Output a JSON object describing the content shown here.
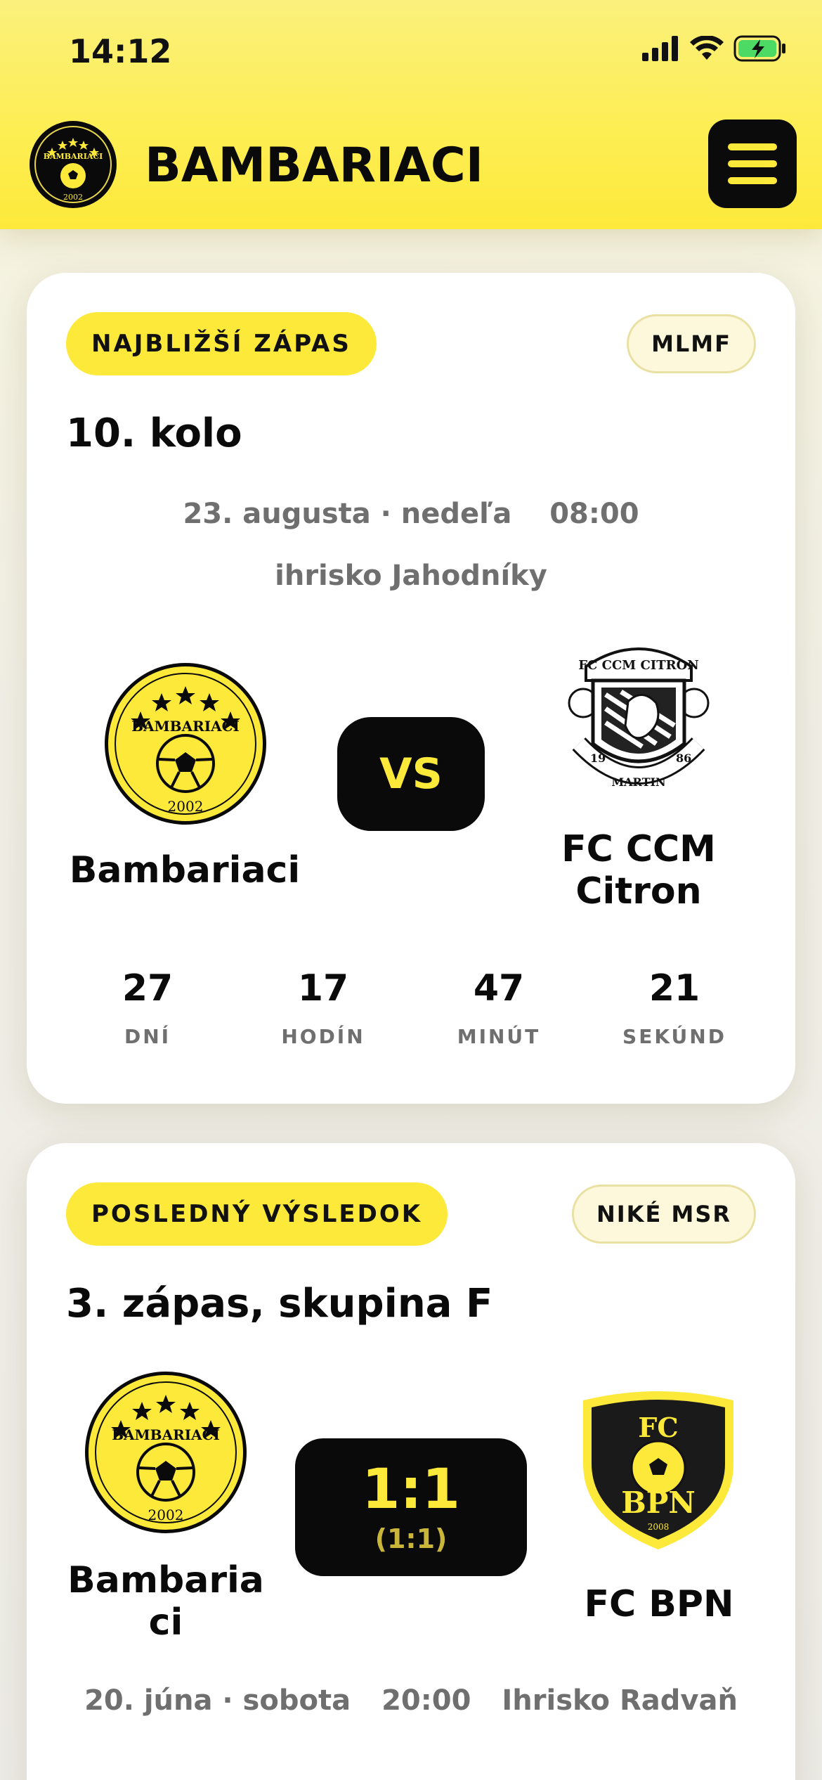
{
  "status_bar": {
    "time": "14:12"
  },
  "header": {
    "brand_name": "BAMBARIACI"
  },
  "next_match": {
    "label": "NAJBLIŽŠÍ ZÁPAS",
    "competition": "MLMF",
    "round": "10. kolo",
    "date": "23. augusta · nedeľa",
    "time": "08:00",
    "venue": "ihrisko Jahodníky",
    "home_team": "Bambariaci",
    "away_team_line1": "FC CCM",
    "away_team_line2": "Citron",
    "vs": "VS",
    "countdown": [
      {
        "value": "27",
        "label": "DNÍ"
      },
      {
        "value": "17",
        "label": "HODÍN"
      },
      {
        "value": "47",
        "label": "MINÚT"
      },
      {
        "value": "21",
        "label": "SEKÚND"
      }
    ]
  },
  "last_result": {
    "label": "POSLEDNÝ VÝSLEDOK",
    "competition": "NIKÉ MSR",
    "round": "3. zápas, skupina F",
    "home_team_line1": "Bambaria",
    "home_team_line2": "ci",
    "away_team": "FC BPN",
    "score": "1:1",
    "half_time": "(1:1)",
    "date": "20. júna · sobota",
    "time": "20:00",
    "venue": "Ihrisko Radvaň"
  },
  "logos": {
    "bambariaci_text": "BAMBARIACI",
    "bambariaci_year": "2002",
    "ccm_top": "FC CCM CITRON",
    "ccm_bottom": "MARTIN",
    "ccm_left": "19",
    "ccm_right": "86",
    "bpn_fc": "FC",
    "bpn_name": "BPN",
    "bpn_year": "2008"
  },
  "colors": {
    "accent": "#fde93a",
    "dark": "#0a0a0a",
    "muted": "#6f6f6f"
  }
}
